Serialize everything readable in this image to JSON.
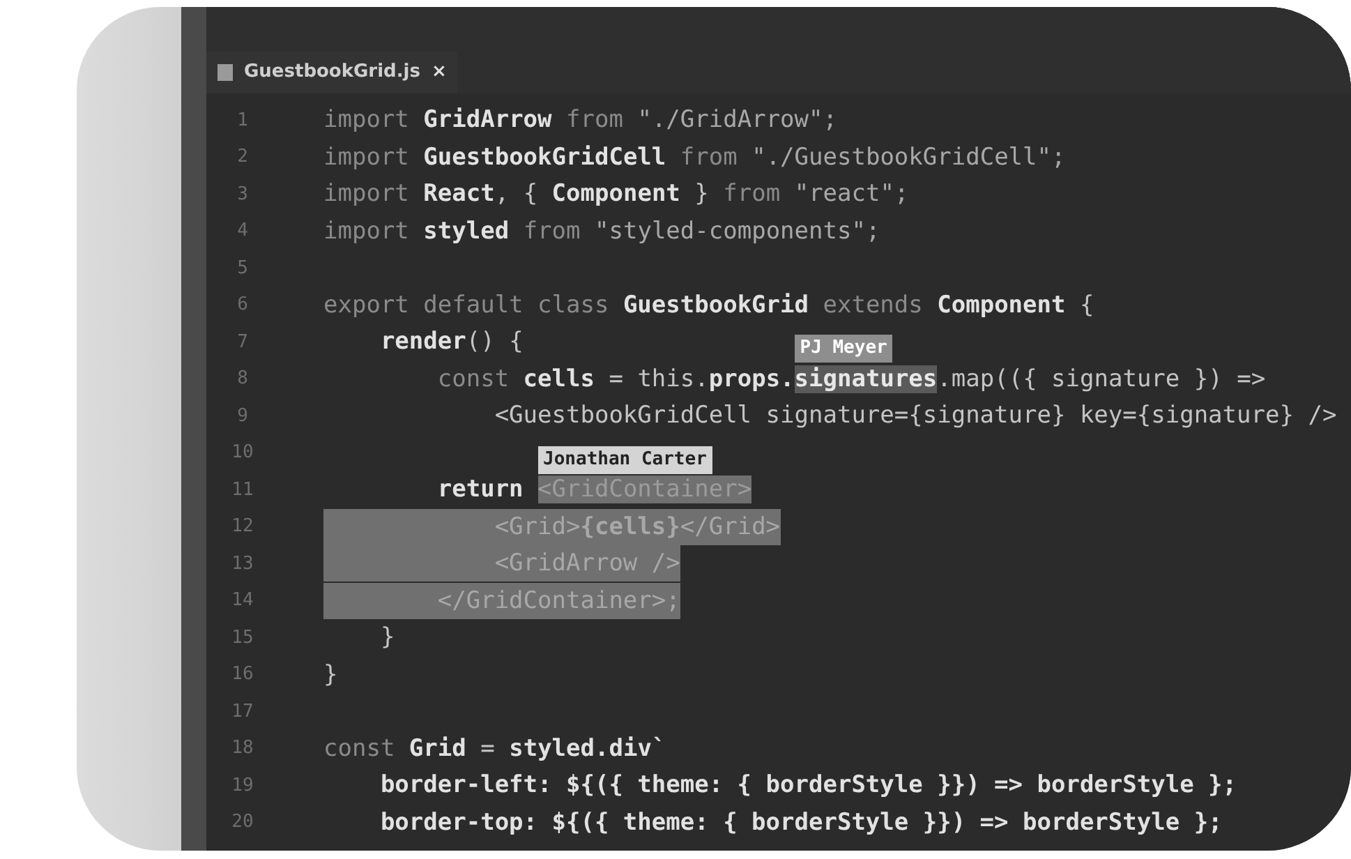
{
  "tab": {
    "title": "GuestbookGrid.js",
    "close": "×"
  },
  "lines": [
    {
      "number": "1",
      "selected": false,
      "segments": [
        {
          "text": "import ",
          "kind": "keyword"
        },
        {
          "text": "GridArrow",
          "kind": "name"
        },
        {
          "text": " from ",
          "kind": "keyword"
        },
        {
          "text": "\"./GridArrow\";",
          "kind": "string"
        }
      ]
    },
    {
      "number": "2",
      "selected": false,
      "segments": [
        {
          "text": "import ",
          "kind": "keyword"
        },
        {
          "text": "GuestbookGridCell",
          "kind": "name"
        },
        {
          "text": " from ",
          "kind": "keyword"
        },
        {
          "text": "\"./GuestbookGridCell\";",
          "kind": "string"
        }
      ]
    },
    {
      "number": "3",
      "selected": false,
      "segments": [
        {
          "text": "import ",
          "kind": "keyword"
        },
        {
          "text": "React",
          "kind": "name"
        },
        {
          "text": ", { ",
          "kind": "plain"
        },
        {
          "text": "Component",
          "kind": "name"
        },
        {
          "text": " } ",
          "kind": "plain"
        },
        {
          "text": "from ",
          "kind": "keyword"
        },
        {
          "text": "\"react\";",
          "kind": "string"
        }
      ]
    },
    {
      "number": "4",
      "selected": false,
      "segments": [
        {
          "text": "import ",
          "kind": "keyword"
        },
        {
          "text": "styled",
          "kind": "name"
        },
        {
          "text": " from ",
          "kind": "keyword"
        },
        {
          "text": "\"styled-components\";",
          "kind": "string"
        }
      ]
    },
    {
      "number": "5"
    },
    {
      "number": "6",
      "selected": false,
      "segments": [
        {
          "text": "export default class ",
          "kind": "keyword"
        },
        {
          "text": "GuestbookGrid",
          "kind": "name"
        },
        {
          "text": " extends ",
          "kind": "keyword"
        },
        {
          "text": "Component",
          "kind": "name"
        },
        {
          "text": " {",
          "kind": "plain"
        }
      ]
    },
    {
      "number": "7",
      "selected": false,
      "segments": [
        {
          "text": "    render",
          "kind": "name"
        },
        {
          "text": "() {",
          "kind": "plain"
        }
      ]
    },
    {
      "number": "8",
      "selected": false,
      "segments": [
        {
          "text": "        const ",
          "kind": "keyword"
        },
        {
          "text": "cells",
          "kind": "name"
        },
        {
          "text": " = this.",
          "kind": "plain"
        },
        {
          "text": "props.",
          "kind": "name"
        },
        {
          "text": "signatures",
          "kind": "highlighted",
          "label": {
            "text": "PJ Meyer",
            "color": "#8e8e8e"
          }
        },
        {
          "text": ".map(({ signature }) =>",
          "kind": "plain"
        }
      ]
    },
    {
      "number": "9",
      "selected": false,
      "segments": [
        {
          "text": "            <GuestbookGridCell signature={signature} key={signature} />",
          "kind": "plain"
        }
      ]
    },
    {
      "number": "10"
    },
    {
      "number": "11",
      "selected": false,
      "segments": [
        {
          "text": "        return ",
          "kind": "name"
        },
        {
          "text": "<GridContainer>",
          "kind": "selected",
          "label": {
            "text": "Jonathan Carter",
            "color": "#d4d4d4"
          }
        }
      ]
    },
    {
      "number": "12",
      "selected": true,
      "segments": [
        {
          "text": "            <Grid>",
          "kind": "string"
        },
        {
          "text": "{cells}",
          "kind": "name"
        },
        {
          "text": "</Grid>",
          "kind": "string"
        }
      ]
    },
    {
      "number": "13",
      "selected": true,
      "segments": [
        {
          "text": "            <GridArrow />",
          "kind": "string"
        }
      ]
    },
    {
      "number": "14",
      "selected": true,
      "segments": [
        {
          "text": "        </GridContainer>;",
          "kind": "string"
        }
      ]
    },
    {
      "number": "15",
      "selected": false,
      "segments": [
        {
          "text": "    }",
          "kind": "plain"
        }
      ]
    },
    {
      "number": "16",
      "selected": false,
      "segments": [
        {
          "text": "}",
          "kind": "plain"
        }
      ]
    },
    {
      "number": "17"
    },
    {
      "number": "18",
      "selected": false,
      "segments": [
        {
          "text": "const ",
          "kind": "keyword"
        },
        {
          "text": "Grid",
          "kind": "name"
        },
        {
          "text": " = ",
          "kind": "plain"
        },
        {
          "text": "styled.div`",
          "kind": "name"
        }
      ]
    },
    {
      "number": "19",
      "selected": false,
      "segments": [
        {
          "text": "    border-left: ${({ theme: { borderStyle }}) => borderStyle };",
          "kind": "name"
        }
      ]
    },
    {
      "number": "20",
      "selected": false,
      "segments": [
        {
          "text": "    border-top: ${({ theme: { borderStyle }}) => borderStyle };",
          "kind": "name"
        }
      ]
    }
  ]
}
